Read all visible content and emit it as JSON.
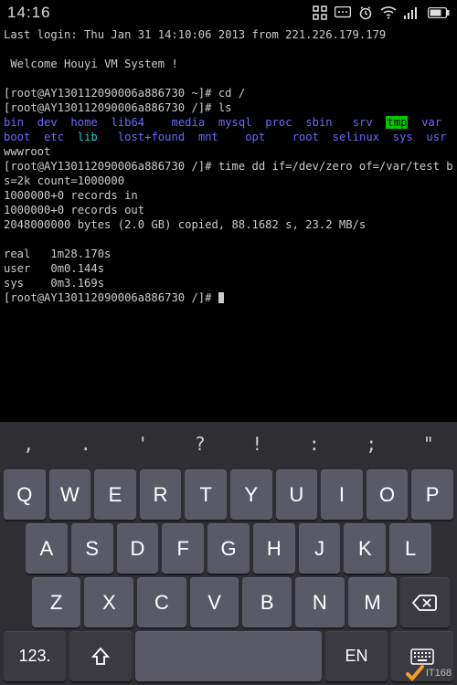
{
  "status": {
    "time": "14:16"
  },
  "terminal": {
    "last_login": "Last login: Thu Jan 31 14:10:06 2013 from 221.226.179.179",
    "welcome_blank": "",
    "welcome": " Welcome Houyi VM System !",
    "blank1": "",
    "prompt_host": "root@AY130112090006a886730",
    "cd_cmd": "cd /",
    "ls_cmd": "ls",
    "dirs_row1": {
      "bin": "bin",
      "dev": "dev",
      "home": "home",
      "lib64": "lib64",
      "media": "media",
      "mysql": "mysql",
      "proc": "proc",
      "sbin": "sbin",
      "srv": "srv",
      "tmp": "tmp",
      "var": "var"
    },
    "dirs_row2": {
      "boot": "boot",
      "etc": "etc",
      "lib": "lib",
      "lostfound": "lost+found",
      "mnt": "mnt",
      "opt": "opt",
      "root": "root",
      "selinux": "selinux",
      "sys": "sys",
      "usr": "usr",
      "wwwroot": "wwwroot"
    },
    "dd_cmd": "time dd if=/dev/zero of=/var/test bs=2k count=1000000",
    "rec_in": "1000000+0 records in",
    "rec_out": "1000000+0 records out",
    "bytes": "2048000000 bytes (2.0 GB) copied, 88.1682 s, 23.2 MB/s",
    "blank2": "",
    "time_real": "real   1m28.170s",
    "time_user": "user   0m0.144s",
    "time_sys": "sys    0m3.169s"
  },
  "keyboard": {
    "punct": [
      ",",
      ".",
      "'",
      "?",
      "!",
      ":",
      ";",
      "\""
    ],
    "row1": [
      "Q",
      "W",
      "E",
      "R",
      "T",
      "Y",
      "U",
      "I",
      "O",
      "P"
    ],
    "row2": [
      "A",
      "S",
      "D",
      "F",
      "G",
      "H",
      "J",
      "K",
      "L"
    ],
    "row3": [
      "Z",
      "X",
      "C",
      "V",
      "B",
      "N",
      "M"
    ],
    "numkey": "123.",
    "lang": "EN"
  },
  "watermark": "IT168"
}
